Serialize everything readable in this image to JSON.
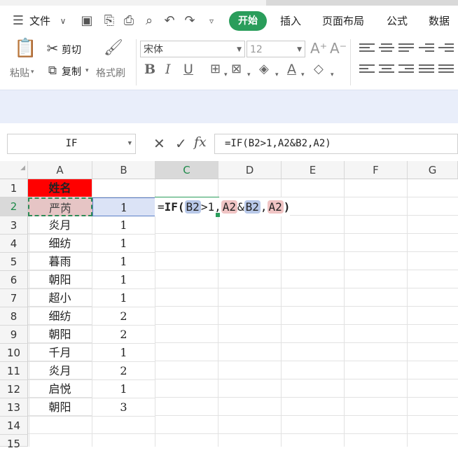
{
  "menu": {
    "file_label": "文件",
    "tabs": [
      {
        "label": "开始",
        "active": true
      },
      {
        "label": "插入"
      },
      {
        "label": "页面布局"
      },
      {
        "label": "公式"
      },
      {
        "label": "数据"
      }
    ]
  },
  "ribbon": {
    "paste_label": "粘贴",
    "cut_label": "剪切",
    "copy_label": "复制",
    "format_painter_label": "格式刷",
    "font_name": "宋体",
    "font_size": "12"
  },
  "formula_bar": {
    "name_box": "IF",
    "formula": "=IF(B2>1,A2&B2,A2)"
  },
  "editing": {
    "eq": "=",
    "fn": "IF",
    "open": "(",
    "ref1": "B2",
    "gt": ">1,",
    "ref2": "A2",
    "amp": "&",
    "ref3": "B2",
    "comma": ",",
    "ref4": "A2",
    "close": ")"
  },
  "sheet": {
    "columns": [
      "A",
      "B",
      "C",
      "D",
      "E",
      "F",
      "G"
    ],
    "rows": [
      "1",
      "2",
      "3",
      "4",
      "5",
      "6",
      "7",
      "8",
      "9",
      "10",
      "11",
      "12",
      "13",
      "14",
      "15"
    ],
    "header_cell": "姓名",
    "names": [
      "严芮",
      "炎月",
      "细纺",
      "暮雨",
      "朝阳",
      "超小",
      "细纺",
      "朝阳",
      "千月",
      "炎月",
      "启悦",
      "朝阳"
    ],
    "values": [
      "1",
      "1",
      "1",
      "1",
      "1",
      "1",
      "2",
      "2",
      "1",
      "2",
      "1",
      "3"
    ]
  },
  "colors": {
    "accent": "#2a9d5b",
    "header_fill": "#ff0000",
    "selected_fill": "#e6c5c5",
    "ref_blue": "#b8c8e8",
    "ref_red": "#f0c4c4"
  }
}
